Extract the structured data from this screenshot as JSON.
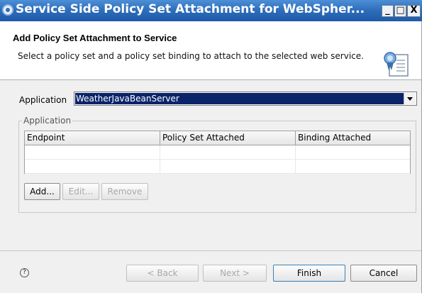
{
  "window": {
    "title": "Service Side Policy Set Attachment for WebSpher...",
    "controls": {
      "minimize": "_",
      "maximize": "□",
      "close": "X"
    }
  },
  "header": {
    "title": "Add Policy Set Attachment to Service",
    "description": "Select a policy set and a policy set binding to attach to the selected web service.",
    "icon": "certificate-icon"
  },
  "form": {
    "application_label": "Application",
    "application_value": "WeatherJavaBeanServer"
  },
  "group": {
    "label": "Application",
    "table": {
      "columns": [
        "Endpoint",
        "Policy Set Attached",
        "Binding Attached"
      ],
      "rows": [
        [
          "",
          "",
          ""
        ],
        [
          "",
          "",
          ""
        ]
      ]
    },
    "buttons": {
      "add": "Add...",
      "edit": "Edit...",
      "remove": "Remove"
    }
  },
  "footer": {
    "help_icon": "?",
    "back": "< Back",
    "next": "Next >",
    "finish": "Finish",
    "cancel": "Cancel"
  },
  "colors": {
    "titlebar": "#2f6fbc",
    "selection": "#0a246a",
    "dialog_bg": "#f0f0f0"
  }
}
